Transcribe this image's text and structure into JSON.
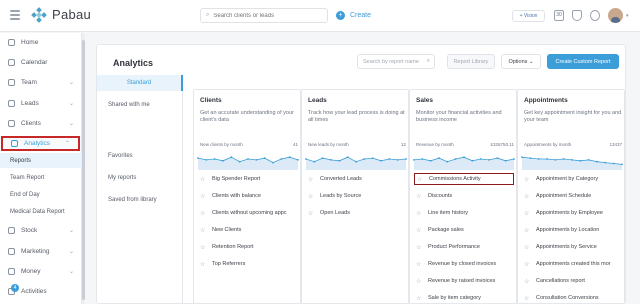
{
  "app": {
    "brand": "Pabau",
    "search_placeholder": "Search clients or leads",
    "create_label": "Create",
    "vision_label": "+ Vision",
    "calendar_day": "30"
  },
  "sidebar": {
    "items": [
      {
        "label": "Home",
        "icon": "home-icon"
      },
      {
        "label": "Calendar",
        "icon": "calendar-icon"
      },
      {
        "label": "Team",
        "icon": "team-icon"
      },
      {
        "label": "Leads",
        "icon": "leads-icon"
      },
      {
        "label": "Clients",
        "icon": "clients-icon"
      },
      {
        "label": "Analytics",
        "icon": "analytics-icon"
      },
      {
        "label": "Stock",
        "icon": "stock-icon"
      },
      {
        "label": "Marketing",
        "icon": "marketing-icon"
      },
      {
        "label": "Money",
        "icon": "money-icon"
      },
      {
        "label": "Activities",
        "icon": "activities-icon"
      }
    ],
    "subitems": [
      "Reports",
      "Team Report",
      "End of Day",
      "Medical Data Report"
    ],
    "activities_badge": "4"
  },
  "analytics": {
    "title": "Analytics",
    "search_placeholder": "Search by report name",
    "library_label": "Report Library",
    "options_label": "Options",
    "custom_label": "Create Custom Report",
    "tabs": [
      "Standard",
      "Shared with me",
      "Favorites",
      "My reports",
      "Saved from library"
    ]
  },
  "columns": [
    {
      "title": "Clients",
      "desc": "Get an accurate understanding of your client's data",
      "metric_label": "New clients by month",
      "metric_value": "41",
      "spark": [
        0.55,
        0.45,
        0.5,
        0.4,
        0.6,
        0.35,
        0.5,
        0.45,
        0.55,
        0.3,
        0.5,
        0.6,
        0.45
      ],
      "items": [
        "Big Spender Report",
        "Clients with balance",
        "Clients without upcoming appc",
        "New Clients",
        "Retention Report",
        "Top Referrers"
      ]
    },
    {
      "title": "Leads",
      "desc": "Track how your lead process is doing at all times",
      "metric_label": "New leads by month",
      "metric_value": "12",
      "spark": [
        0.5,
        0.35,
        0.55,
        0.45,
        0.4,
        0.6,
        0.35,
        0.5,
        0.55,
        0.4,
        0.5,
        0.45,
        0.5
      ],
      "items": [
        "Converted Leads",
        "Leads by Source",
        "Open Leads"
      ]
    },
    {
      "title": "Sales",
      "desc": "Monitor your financial activities and business income",
      "metric_label": "Revenue by month",
      "metric_value": "£326750.11",
      "spark": [
        0.45,
        0.5,
        0.4,
        0.55,
        0.35,
        0.5,
        0.6,
        0.4,
        0.5,
        0.45,
        0.55,
        0.4,
        0.5
      ],
      "items": [
        "Commissions Activity",
        "Discounts",
        "Line item history",
        "Package sales",
        "Product Performance",
        "Revenue by closed invoices",
        "Revenue by raised invoices",
        "Sale by item category"
      ]
    },
    {
      "title": "Appointments",
      "desc": "Get key appointment insight for you and your team",
      "metric_label": "Appointments by month",
      "metric_value": "13437",
      "spark": [
        0.6,
        0.55,
        0.5,
        0.5,
        0.45,
        0.5,
        0.45,
        0.4,
        0.45,
        0.35,
        0.3,
        0.25,
        0.2
      ],
      "items": [
        "Appointment by Category",
        "Appointment Schedule",
        "Appointments by Employee",
        "Appointments by Location",
        "Appointments by Service",
        "Appointments created this mor",
        "Cancellations report",
        "Consultation Conversions"
      ]
    }
  ],
  "colors": {
    "accent": "#3b9ed8",
    "highlight": "#8b1a1a",
    "spark_fill": "#dbeaf6"
  }
}
